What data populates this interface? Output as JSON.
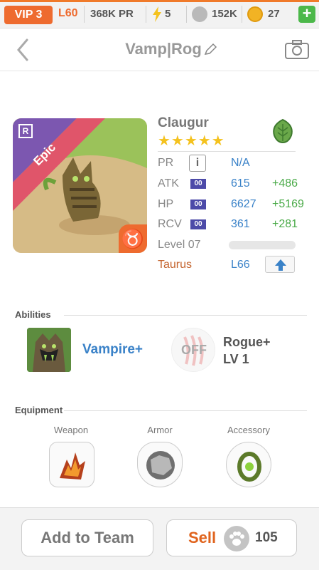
{
  "status_bar": {
    "vip": "VIP 3",
    "level": "L60",
    "pr": "368K PR",
    "energy": "5",
    "coins": "152K",
    "gold": "27",
    "add_label": "+"
  },
  "header": {
    "title": "Vamp|Rog"
  },
  "creature": {
    "rarity": "Epic",
    "rarity_badge": "R",
    "zodiac_symbol": "♉",
    "name": "Claugur",
    "stars": "★★★★★",
    "element_icon": "leaf-icon",
    "stats": [
      {
        "label": "PR",
        "value": "N/A",
        "bonus": ""
      },
      {
        "label": "ATK",
        "tag": "00",
        "value": "615",
        "bonus": "+486"
      },
      {
        "label": "HP",
        "tag": "00",
        "value": "6627",
        "bonus": "+5169"
      },
      {
        "label": "RCV",
        "tag": "00",
        "value": "361",
        "bonus": "+281"
      }
    ],
    "level": "Level 07",
    "level_progress": 0.0,
    "zodiac": "Taurus",
    "zodiac_level": "L66"
  },
  "abilities": {
    "title": "Abilities",
    "primary": "Vampire+",
    "secondary_state": "OFF",
    "secondary_name": "Rogue+",
    "secondary_level": "LV 1"
  },
  "equipment": {
    "title": "Equipment",
    "slots": [
      {
        "label": "Weapon"
      },
      {
        "label": "Armor"
      },
      {
        "label": "Accessory"
      }
    ]
  },
  "bottom": {
    "add_to_team": "Add to Team",
    "sell": "Sell",
    "sell_price": "105"
  },
  "colors": {
    "accent": "#ee6b2f",
    "blue": "#3a82c8",
    "green": "#4aaa48",
    "epic_ribbon": "#e0556a",
    "r_badge_bg": "#6b4fa8"
  }
}
